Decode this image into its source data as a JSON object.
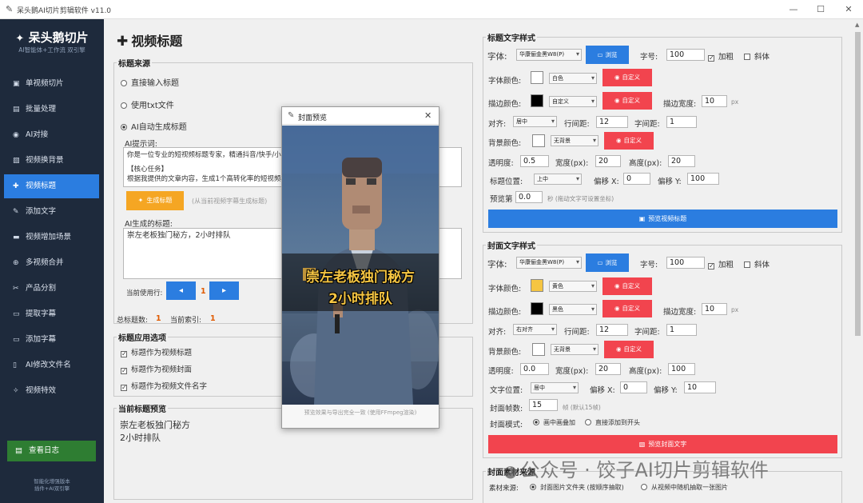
{
  "window": {
    "title": "呆头鹅AI切片剪辑软件 v11.0"
  },
  "sidebar": {
    "brand": "呆头鹅切片",
    "subtitle": "AI智能体+工作流 双引擎",
    "items": [
      {
        "label": "单视频切片",
        "icon": "film-icon"
      },
      {
        "label": "批量处理",
        "icon": "batch-icon"
      },
      {
        "label": "AI对接",
        "icon": "robot-icon"
      },
      {
        "label": "视频换背景",
        "icon": "image-icon"
      },
      {
        "label": "视频标题",
        "icon": "title-icon",
        "active": true
      },
      {
        "label": "添加文字",
        "icon": "text-icon"
      },
      {
        "label": "视频增加场景",
        "icon": "scene-icon"
      },
      {
        "label": "多视频合并",
        "icon": "merge-icon"
      },
      {
        "label": "产品分割",
        "icon": "scissors-icon"
      },
      {
        "label": "提取字幕",
        "icon": "subtitle-icon"
      },
      {
        "label": "添加字幕",
        "icon": "caption-icon"
      },
      {
        "label": "AI修改文件名",
        "icon": "file-icon"
      },
      {
        "label": "视频特效",
        "icon": "magic-icon"
      }
    ],
    "log_button": "查看日志",
    "footer_line1": "智能化增强版本",
    "footer_line2": "插件+AI双引擎"
  },
  "page": {
    "title": "视频标题"
  },
  "title_source": {
    "legend": "标题来源",
    "option_direct": "直接输入标题",
    "option_txt": "使用txt文件",
    "option_ai": "AI自动生成标题",
    "prompt_label": "AI提示词:",
    "prompt_line1": "你是一位专业的短视频标题专家，精通抖音/快手/小红",
    "prompt_line2": "【核心任务】",
    "prompt_line3": "根据我提供的文章内容，生成1个高转化率的短视频标题",
    "generate_button": "生成标题",
    "generate_hint": "(从当前视频字幕生成标题)",
    "generated_label": "AI生成的标题:",
    "generated_text": "崇左老板独门秘方，2小时排队",
    "current_row_label": "当前使用行:",
    "current_row": "1",
    "total_label": "总标题数:",
    "total": "1",
    "index_label": "当前索引:",
    "index": "1"
  },
  "apply": {
    "legend": "标题应用选项",
    "opt1": "标题作为视频标题",
    "opt2": "标题作为视频封面",
    "opt3": "标题作为视频文件名字"
  },
  "current_preview": {
    "legend": "当前标题预览",
    "line1": "崇左老板独门秘方",
    "line2": "2小时排队"
  },
  "title_style": {
    "legend": "标题文字样式",
    "font_label": "字体:",
    "font_value": "华康俪金黑W8(P)",
    "browse": "浏览",
    "size_label": "字号:",
    "size": "100",
    "bold": "加粗",
    "italic": "斜体",
    "font_color_label": "字体颜色:",
    "font_color": "白色",
    "custom": "自定义",
    "stroke_color_label": "描边颜色:",
    "stroke_color": "自定义",
    "stroke_width_label": "描边宽度:",
    "stroke_width": "10",
    "px": "px",
    "align_label": "对齐:",
    "align": "居中",
    "line_spacing_label": "行间距:",
    "line_spacing": "12",
    "char_spacing_label": "字间距:",
    "char_spacing": "1",
    "bg_color_label": "背景颜色:",
    "bg_color": "无背景",
    "opacity_label": "透明度:",
    "opacity": "0.5",
    "width_label": "宽度(px):",
    "width": "20",
    "height_label": "高度(px):",
    "height": "20",
    "pos_label": "标题位置:",
    "pos": "上中",
    "offx_label": "偏移 X:",
    "offx": "0",
    "offy_label": "偏移 Y:",
    "offy": "100",
    "preview_frame_label": "预览第",
    "preview_frame": "0.0",
    "preview_frame_hint": "秒  (拖动文字可设置坐标)",
    "preview_button": "预览视频标题",
    "font_color_hex": "#ffffff",
    "stroke_color_hex": "#000000",
    "bg_color_hex": "#ffffff"
  },
  "cover_style": {
    "legend": "封面文字样式",
    "font_label": "字体:",
    "font_value": "华康俪金黑W8(P)",
    "browse": "浏览",
    "size_label": "字号:",
    "size": "100",
    "bold": "加粗",
    "italic": "斜体",
    "font_color_label": "字体颜色:",
    "font_color": "黄色",
    "custom": "自定义",
    "stroke_color_label": "描边颜色:",
    "stroke_color": "黑色",
    "stroke_width_label": "描边宽度:",
    "stroke_width": "10",
    "px": "px",
    "align_label": "对齐:",
    "align": "右对齐",
    "line_spacing_label": "行间距:",
    "line_spacing": "12",
    "char_spacing_label": "字间距:",
    "char_spacing": "1",
    "bg_color_label": "背景颜色:",
    "bg_color": "无背景",
    "opacity_label": "透明度:",
    "opacity": "0.0",
    "width_label": "宽度(px):",
    "width": "20",
    "height_label": "高度(px):",
    "height": "100",
    "pos_label": "文字位置:",
    "pos": "居中",
    "offx_label": "偏移 X:",
    "offx": "0",
    "offy_label": "偏移 Y:",
    "offy": "10",
    "frames_label": "封面帧数:",
    "frames": "15",
    "frames_hint": "帧 (默认15帧)",
    "mode_label": "封面模式:",
    "mode_overlay": "画中画叠加",
    "mode_prepend": "直接添加到开头",
    "preview_button": "预览封面文字",
    "font_color_hex": "#f5c542",
    "stroke_color_hex": "#000000",
    "bg_color_hex": "#ffffff"
  },
  "material": {
    "legend": "封面素材来源",
    "label": "素材来源:",
    "opt1": "封面图片文件夹 (按顺序抽取)",
    "opt2": "从视频中随机抽取一张图片"
  },
  "preview_dialog": {
    "title": "封面预览",
    "line1": "崇左老板独门秘方",
    "line2": "2小时排队",
    "caption": "预览效果与导出完全一致 (使用FFmpeg渲染)"
  },
  "watermark": "公众号 · 饺子AI切片剪辑软件",
  "colors": {
    "accent": "#2b7de0",
    "sidebar": "#1e2a3c",
    "danger": "#f2444e",
    "warning": "#f5a623",
    "success": "#2e7d32"
  }
}
